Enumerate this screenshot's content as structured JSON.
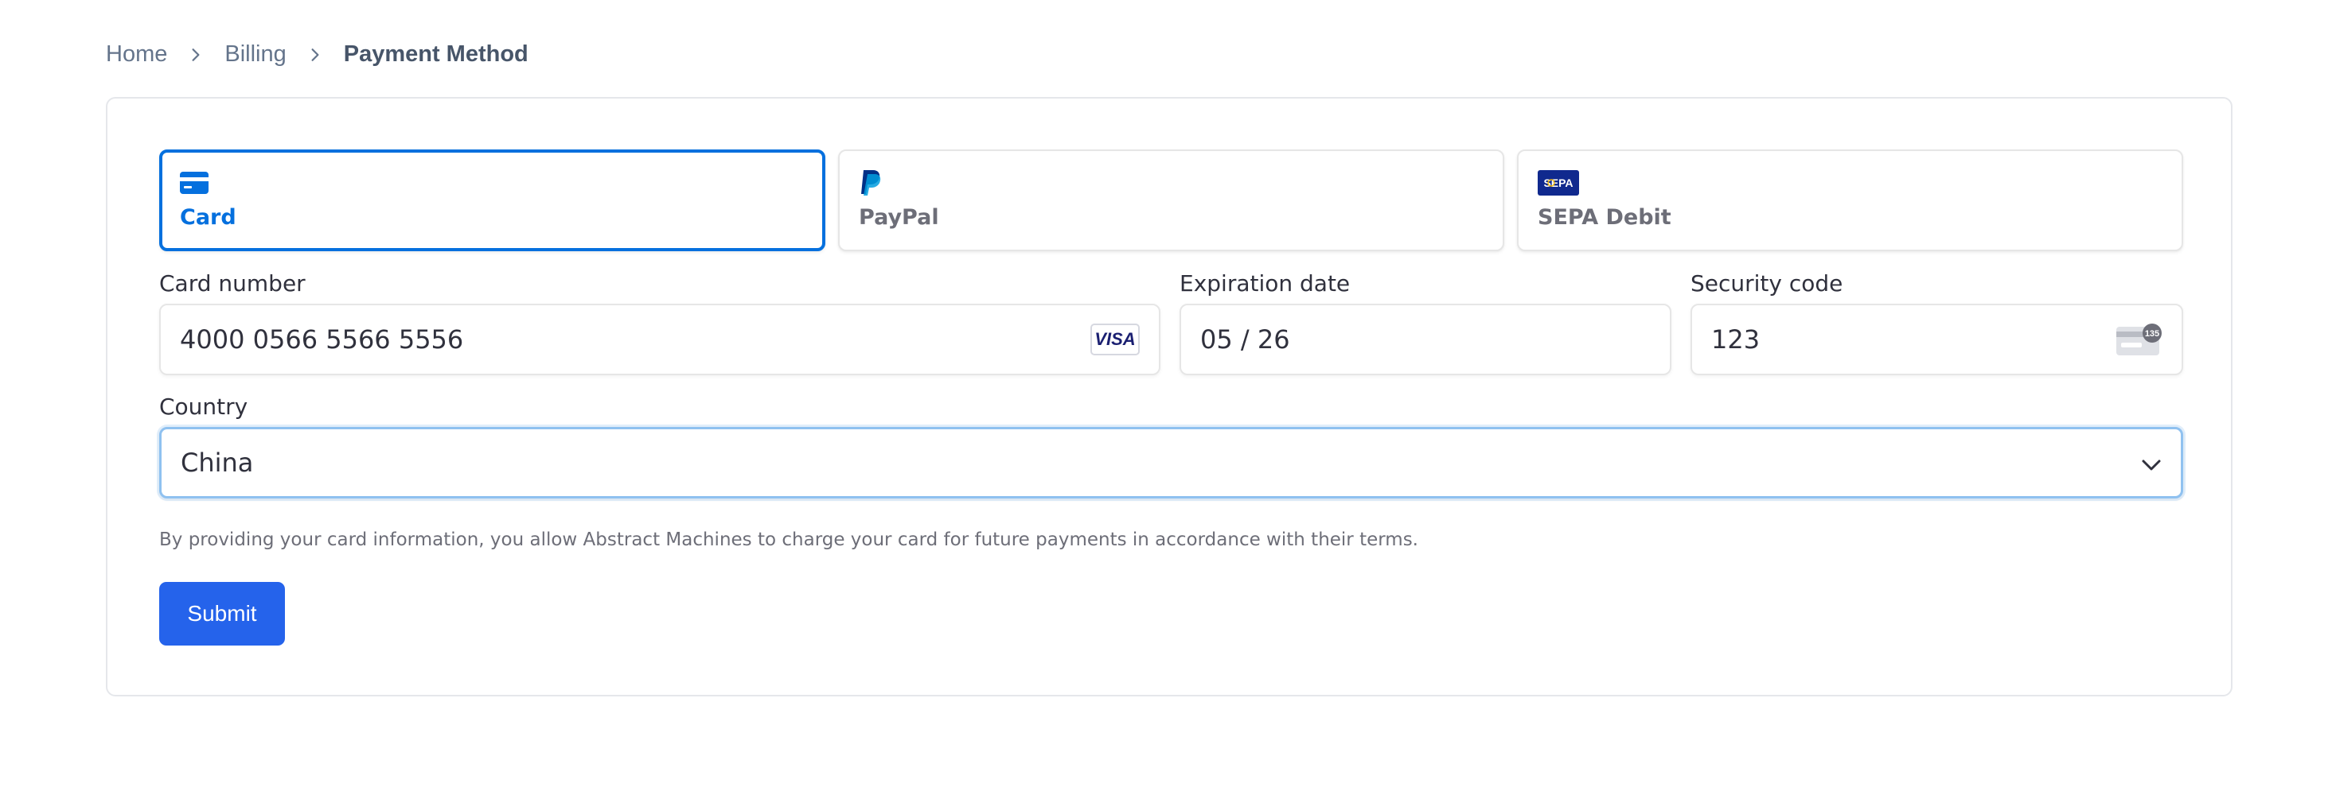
{
  "breadcrumb": {
    "items": [
      "Home",
      "Billing",
      "Payment Method"
    ]
  },
  "payment_tabs": [
    {
      "label": "Card",
      "icon": "credit-card-icon",
      "active": true
    },
    {
      "label": "PayPal",
      "icon": "paypal-icon",
      "active": false
    },
    {
      "label": "SEPA Debit",
      "icon": "sepa-icon",
      "icon_text": "SEPA",
      "active": false
    }
  ],
  "form": {
    "card_number": {
      "label": "Card number",
      "value": "4000 0566 5566 5556",
      "brand": "VISA"
    },
    "expiration": {
      "label": "Expiration date",
      "value": "05 / 26"
    },
    "security_code": {
      "label": "Security code",
      "value": "123",
      "icon_text": "135"
    },
    "country": {
      "label": "Country",
      "value": "China"
    }
  },
  "disclaimer": "By providing your card information, you allow Abstract Machines to charge your card for future payments in accordance with their terms.",
  "submit_label": "Submit",
  "colors": {
    "accent": "#0570de",
    "button": "#2563eb",
    "focus_border": "#8fc1f0"
  }
}
